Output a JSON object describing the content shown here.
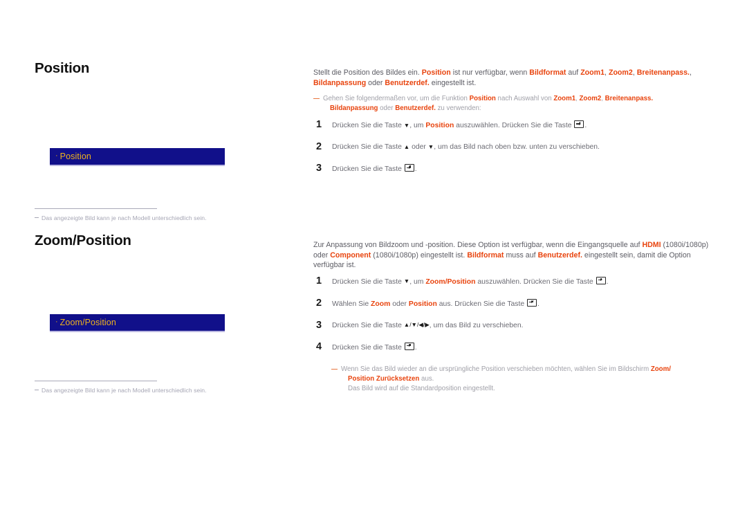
{
  "sections": [
    {
      "id": "position",
      "heading": "Position",
      "menu_box": {
        "bullet": "·",
        "label": "Position",
        "background": "#11108a",
        "text_color": "#f0b31c",
        "underline_color": "#b9b6e0"
      },
      "footnote": "Das angezeigte Bild kann je nach Modell unterschiedlich sein.",
      "intro": {
        "part1": "Stellt die Position des Bildes ein. ",
        "hl1": "Position",
        "part2": " ist nur verfügbar, wenn ",
        "hl2": "Bildformat",
        "part3": " auf ",
        "hl3": "Zoom1",
        "part4": ", ",
        "hl4": "Zoom2",
        "part5": ", ",
        "hl5": "Breitenanpass.",
        "part6": ", ",
        "hl6": "Bildanpassung",
        "part7": " oder ",
        "hl7": "Benutzerdef.",
        "part8": " eingestellt ist."
      },
      "note": {
        "part1": "Gehen Sie folgendermaßen vor, um die Funktion ",
        "hl1": "Position",
        "part2": " nach Auswahl von ",
        "hl2": "Zoom1",
        "part3": ", ",
        "hl3": "Zoom2",
        "part4": ", ",
        "hl4": "Breitenanpass.",
        "line2_hl1": "Bildanpassung",
        "line2_part1": " oder ",
        "line2_hl2": "Benutzerdef.",
        "line2_part2": " zu verwenden:"
      },
      "steps": [
        {
          "num": "1",
          "part1": "Drücken Sie die Taste ",
          "arrow": "▼",
          "part2": ", um ",
          "hl": "Position",
          "part3": " auszuwählen. Drücken Sie die Taste ",
          "part4": "."
        },
        {
          "num": "2",
          "part1": "Drücken Sie die Taste ",
          "arrow1": "▲",
          "part2": " oder ",
          "arrow2": "▼",
          "part3": ", um das Bild nach oben bzw. unten zu verschieben."
        },
        {
          "num": "3",
          "part1": "Drücken Sie die Taste ",
          "part2": "."
        }
      ]
    },
    {
      "id": "zoompos",
      "heading": "Zoom/Position",
      "menu_box": {
        "bullet": "·",
        "label": "Zoom/Position",
        "background": "#11108a",
        "text_color": "#f0b31c",
        "underline_color": "#b9b6e0"
      },
      "footnote": "Das angezeigte Bild kann je nach Modell unterschiedlich sein.",
      "intro": {
        "part1": "Zur Anpassung von Bildzoom und -position. Diese Option ist verfügbar, wenn die Eingangsquelle auf ",
        "hl1": "HDMI",
        "part2": " (1080i/1080p) oder ",
        "hl2": "Component",
        "part3": " (1080i/1080p) eingestellt ist. ",
        "hl3": "Bildformat",
        "part4": " muss auf ",
        "hl4": "Benutzerdef.",
        "part5": " eingestellt sein, damit die Option verfügbar ist."
      },
      "steps": [
        {
          "num": "1",
          "part1": "Drücken Sie die Taste ",
          "arrow": "▼",
          "part2": ", um ",
          "hl": "Zoom/Position",
          "part3": " auszuwählen. Drücken Sie die Taste ",
          "part4": "."
        },
        {
          "num": "2",
          "part1": "Wählen Sie ",
          "hl1": "Zoom",
          "part2": " oder ",
          "hl2": "Position",
          "part3": " aus. Drücken Sie die Taste ",
          "part4": "."
        },
        {
          "num": "3",
          "part1": "Drücken Sie die Taste ",
          "arrows": "▲/▼/◀/▶",
          "part2": ", um das Bild zu verschieben."
        },
        {
          "num": "4",
          "part1": "Drücken Sie die Taste ",
          "part2": "."
        }
      ],
      "end_note": {
        "part1": "Wenn Sie das Bild wieder an die ursprüngliche Position verschieben möchten, wählen Sie im Bildschirm ",
        "hl1": "Zoom/",
        "hl2": "Position Zurücksetzen",
        "part2": " aus.",
        "line3": "Das Bild wird auf die Standardposition eingestellt."
      }
    }
  ]
}
